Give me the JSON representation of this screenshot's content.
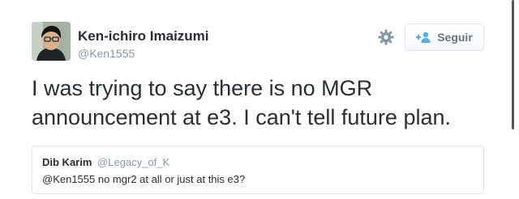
{
  "author": {
    "display_name": "Ken-ichiro Imaizumi",
    "handle": "@Ken1555",
    "avatar_icon": "avatar-photo"
  },
  "actions": {
    "settings_icon": "gear-icon",
    "follow_icon": "add-user-icon",
    "follow_label": "Seguir"
  },
  "tweet": {
    "text": "I was trying to say there is no MGR\nannouncement at e3. I can't tell future plan."
  },
  "quoted_tweet": {
    "name": "Dib Karim",
    "handle": "@Legacy_of_K",
    "text": "@Ken1555 no mgr2 at all or just at this e3?"
  },
  "colors": {
    "text": "#292f33",
    "secondary": "#8899a6",
    "border": "#e1e8ed",
    "button_text": "#66757f",
    "follow_icon_blue": "#55acee"
  }
}
